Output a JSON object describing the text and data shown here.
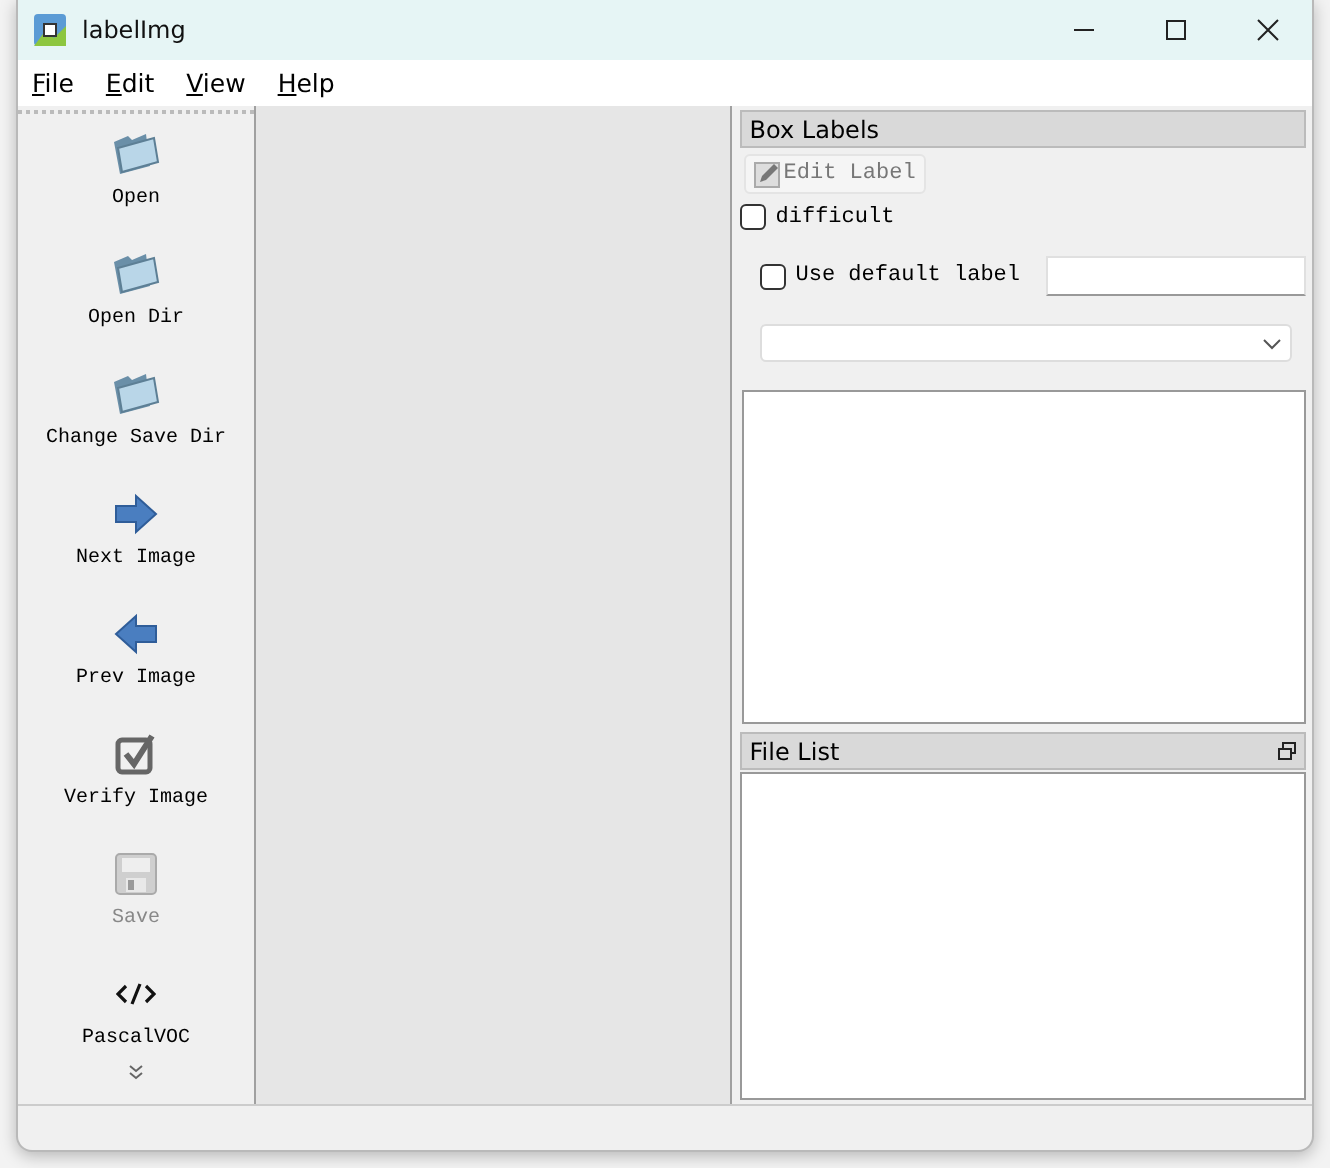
{
  "window": {
    "title": "labelImg"
  },
  "menu": [
    {
      "label": "File"
    },
    {
      "label": "Edit"
    },
    {
      "label": "View"
    },
    {
      "label": "Help"
    }
  ],
  "tools": [
    {
      "label": "Open",
      "kind": "folder",
      "disabled": false
    },
    {
      "label": "Open Dir",
      "kind": "folder",
      "disabled": false
    },
    {
      "label": "Change Save Dir",
      "kind": "folder",
      "disabled": false
    },
    {
      "label": "Next Image",
      "kind": "next",
      "disabled": false
    },
    {
      "label": "Prev Image",
      "kind": "prev",
      "disabled": false
    },
    {
      "label": "Verify Image",
      "kind": "verify",
      "disabled": false
    },
    {
      "label": "Save",
      "kind": "save",
      "disabled": true
    },
    {
      "label": "PascalVOC",
      "kind": "format",
      "disabled": false
    }
  ],
  "box_labels": {
    "title": "Box Labels",
    "edit_button": {
      "label": "Edit Label",
      "disabled": true
    },
    "difficult": {
      "label": "difficult",
      "checked": false
    },
    "use_default": {
      "label": "Use default label",
      "checked": false
    }
  },
  "file_list": {
    "title": "File List"
  }
}
